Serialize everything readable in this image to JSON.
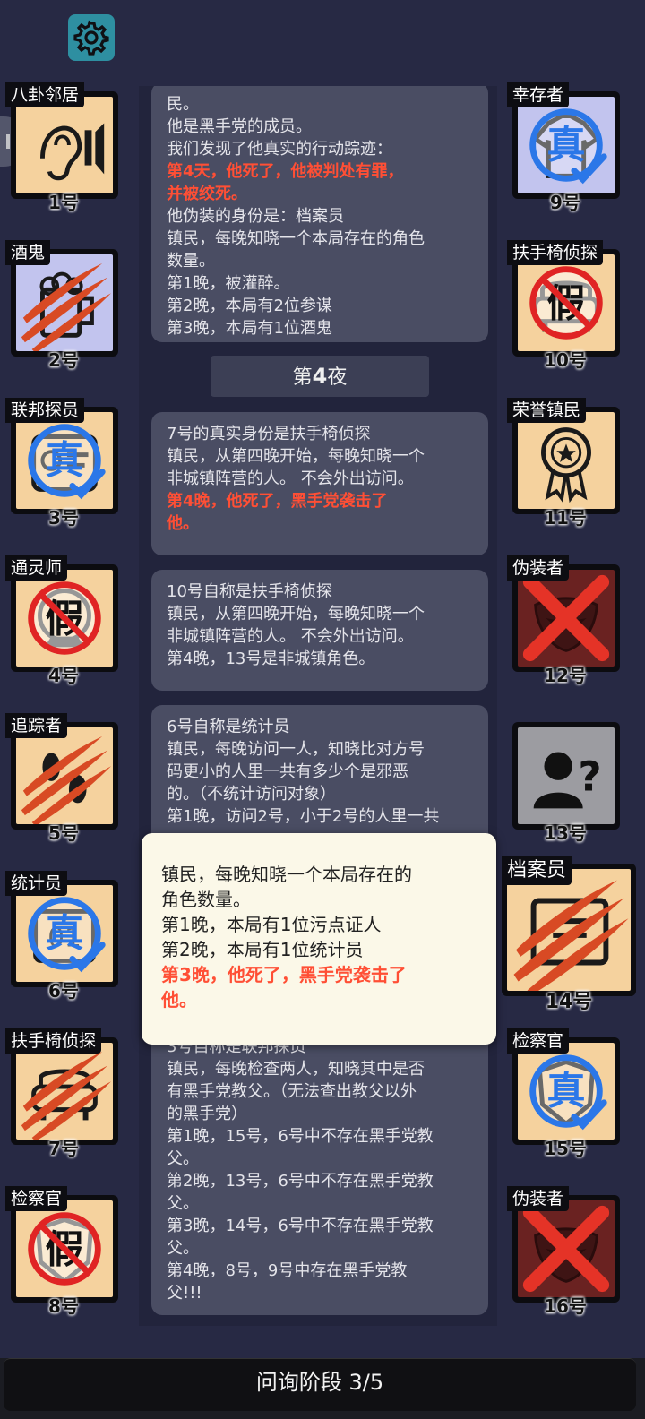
{
  "phase_label": "问询阶段 3/5",
  "night_divider": {
    "prefix": "第",
    "num": "4",
    "suffix": "夜"
  },
  "log": {
    "entry0": {
      "lines": [
        {
          "t": "民。",
          "red": false
        },
        {
          "t": "他是黑手党的成员。",
          "red": false
        },
        {
          "t": "我们发现了他真实的行动踪迹：",
          "red": false
        },
        {
          "t": "第4天，他死了，他被判处有罪，",
          "red": true
        },
        {
          "t": "并被绞死。",
          "red": true
        },
        {
          "t": "他伪装的身份是：档案员",
          "red": false
        },
        {
          "t": "镇民，每晚知晓一个本局存在的角色",
          "red": false
        },
        {
          "t": "数量。",
          "red": false
        },
        {
          "t": "第1晚，被灌醉。",
          "red": false
        },
        {
          "t": "第2晚，本局有2位参谋",
          "red": false
        },
        {
          "t": "第3晚，本局有1位酒鬼",
          "red": false
        }
      ]
    },
    "entry1": {
      "lines": [
        {
          "t": "7号的真实身份是扶手椅侦探",
          "red": false
        },
        {
          "t": "镇民，从第四晚开始，每晚知晓一个",
          "red": false
        },
        {
          "t": "非城镇阵营的人。 不会外出访问。",
          "red": false
        },
        {
          "t": "第4晚，他死了，黑手党袭击了",
          "red": true
        },
        {
          "t": "他。",
          "red": true
        }
      ]
    },
    "entry2": {
      "lines": [
        {
          "t": "10号自称是扶手椅侦探",
          "red": false
        },
        {
          "t": "镇民，从第四晚开始，每晚知晓一个",
          "red": false
        },
        {
          "t": "非城镇阵营的人。 不会外出访问。",
          "red": false
        },
        {
          "t": "第4晚，13号是非城镇角色。",
          "red": false
        }
      ]
    },
    "entry3": {
      "lines": [
        {
          "t": "6号自称是统计员",
          "red": false
        },
        {
          "t": "镇民，每晚访问一人，知晓比对方号",
          "red": false
        },
        {
          "t": "码更小的人里一共有多少个是邪恶",
          "red": false
        },
        {
          "t": "的。（不统计访问对象）",
          "red": false
        },
        {
          "t": "第1晚，访问2号，小于2号的人里一共",
          "red": false
        }
      ]
    },
    "entry4": {
      "lines": [
        {
          "t": "3号自称是联邦探员",
          "red": false
        },
        {
          "t": "镇民，每晚检查两人，知晓其中是否",
          "red": false
        },
        {
          "t": "有黑手党教父。（无法查出教父以外",
          "red": false
        },
        {
          "t": "的黑手党）",
          "red": false
        },
        {
          "t": "第1晚，15号，6号中不存在黑手党教",
          "red": false
        },
        {
          "t": "父。",
          "red": false
        },
        {
          "t": "第2晚，13号，6号中不存在黑手党教",
          "red": false
        },
        {
          "t": "父。",
          "red": false
        },
        {
          "t": "第3晚，14号，6号中不存在黑手党教",
          "red": false
        },
        {
          "t": "父。",
          "red": false
        },
        {
          "t": "第4晚，8号，9号中存在黑手党教",
          "red": false
        },
        {
          "t": "父!!!",
          "red": false
        }
      ]
    }
  },
  "popup": {
    "lines": [
      {
        "t": "镇民，每晚知晓一个本局存在的",
        "red": false
      },
      {
        "t": "角色数量。",
        "red": false
      },
      {
        "t": "第1晚，本局有1位污点证人",
        "red": false
      },
      {
        "t": "第2晚，本局有1位统计员",
        "red": false
      },
      {
        "t": "第3晚，他死了，黑手党袭击了",
        "red": true
      },
      {
        "t": "他。",
        "red": true
      }
    ]
  },
  "players": [
    {
      "id": "p1",
      "name": "八卦邻居",
      "num": "1号",
      "bg": "#f5d29e",
      "icon": "ear-speaker-icon",
      "overlay": "none"
    },
    {
      "id": "p2",
      "name": "酒鬼",
      "num": "2号",
      "bg": "#c2c4ee",
      "icon": "beer-mug-icon",
      "overlay": "claw"
    },
    {
      "id": "p3",
      "name": "联邦探员",
      "num": "3号",
      "bg": "#f5d29e",
      "icon": "badge-id-icon",
      "overlay": "true"
    },
    {
      "id": "p4",
      "name": "通灵师",
      "num": "4号",
      "bg": "#f5d29e",
      "icon": "crystal-icon",
      "overlay": "fake"
    },
    {
      "id": "p5",
      "name": "追踪者",
      "num": "5号",
      "bg": "#f5d29e",
      "icon": "footprints-icon",
      "overlay": "claw"
    },
    {
      "id": "p6",
      "name": "统计员",
      "num": "6号",
      "bg": "#f5d29e",
      "icon": "abacus-icon",
      "overlay": "true"
    },
    {
      "id": "p7",
      "name": "扶手椅侦探",
      "num": "7号",
      "bg": "#f5d29e",
      "icon": "armchair-icon",
      "overlay": "claw"
    },
    {
      "id": "p8",
      "name": "检察官",
      "num": "8号",
      "bg": "#f5d29e",
      "icon": "shield-icon",
      "overlay": "fake"
    },
    {
      "id": "p9",
      "name": "幸存者",
      "num": "9号",
      "bg": "#c2c4ee",
      "icon": "shirt-icon",
      "overlay": "true"
    },
    {
      "id": "p10",
      "name": "扶手椅侦探",
      "num": "10号",
      "bg": "#f5d29e",
      "icon": "armchair-icon",
      "overlay": "fake"
    },
    {
      "id": "p11",
      "name": "荣誉镇民",
      "num": "11号",
      "bg": "#f5d29e",
      "icon": "medal-icon",
      "overlay": "none"
    },
    {
      "id": "p12",
      "name": "伪装者",
      "num": "12号",
      "bg": "#6a2221",
      "icon": "mask-icon",
      "overlay": "cross"
    },
    {
      "id": "p13",
      "name": "",
      "num": "13号",
      "bg": "#9c9ca1",
      "icon": "unknown-person-icon",
      "overlay": "none"
    },
    {
      "id": "p14",
      "name": "档案员",
      "num": "14号",
      "bg": "#f5d29e",
      "icon": "archive-icon",
      "overlay": "claw"
    },
    {
      "id": "p15",
      "name": "检察官",
      "num": "15号",
      "bg": "#f5d29e",
      "icon": "shield-icon",
      "overlay": "true"
    },
    {
      "id": "p16",
      "name": "伪装者",
      "num": "16号",
      "bg": "#6a2221",
      "icon": "mask-icon",
      "overlay": "cross"
    }
  ],
  "colors": {
    "accent_red": "#ff4f35",
    "true_blue": "#2b77e8",
    "fake_red": "#e02424",
    "claw": "#d84a24"
  }
}
